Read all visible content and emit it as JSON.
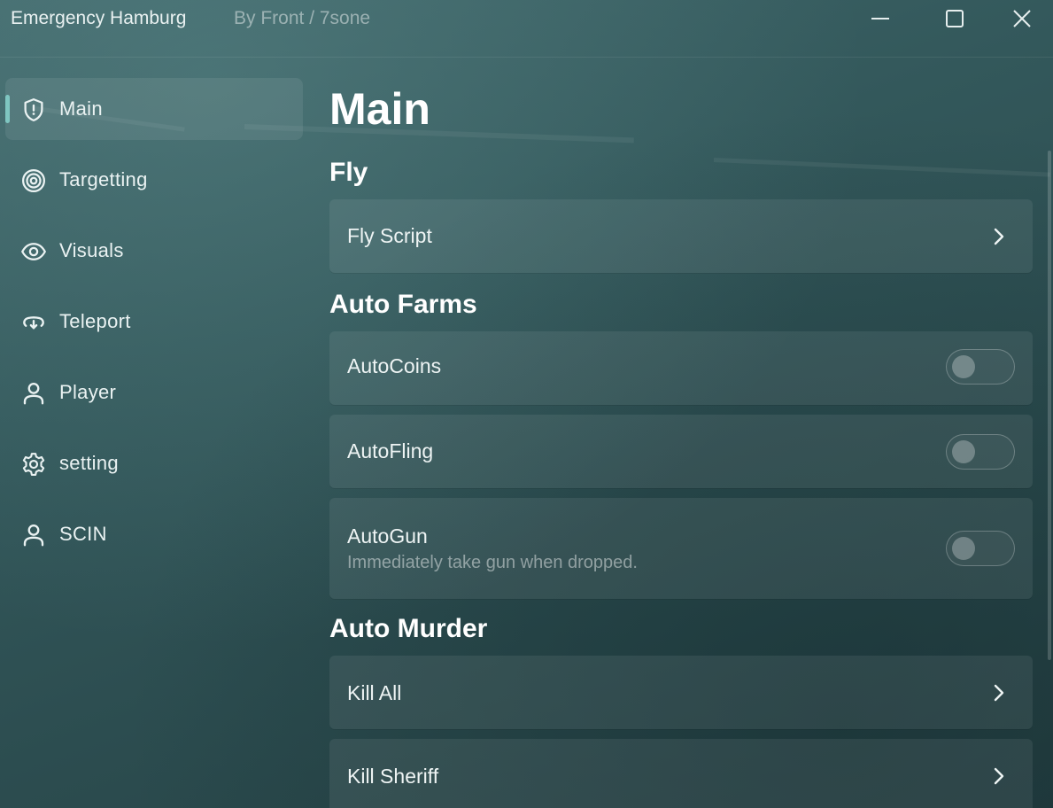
{
  "window": {
    "title": "Emergency Hamburg",
    "subtitle": "By Front / 7sone",
    "accent_color": "#7fc6c1"
  },
  "sidebar": {
    "items": [
      {
        "label": "Main",
        "icon": "shield-alert-icon",
        "active": true
      },
      {
        "label": "Targetting",
        "icon": "target-icon",
        "active": false
      },
      {
        "label": "Visuals",
        "icon": "eye-icon",
        "active": false
      },
      {
        "label": "Teleport",
        "icon": "teleport-icon",
        "active": false
      },
      {
        "label": "Player",
        "icon": "user-icon",
        "active": false
      },
      {
        "label": "setting",
        "icon": "gear-icon",
        "active": false
      },
      {
        "label": "SCIN",
        "icon": "user-icon",
        "active": false
      }
    ]
  },
  "main": {
    "title": "Main",
    "sections": [
      {
        "title": "Fly",
        "rows": [
          {
            "type": "button",
            "label": "Fly Script"
          }
        ]
      },
      {
        "title": "Auto Farms",
        "rows": [
          {
            "type": "toggle",
            "label": "AutoCoins",
            "on": false
          },
          {
            "type": "toggle",
            "label": "AutoFling",
            "on": false
          },
          {
            "type": "toggle",
            "label": "AutoGun",
            "description": "Immediately take gun when dropped.",
            "on": false
          }
        ]
      },
      {
        "title": "Auto Murder",
        "rows": [
          {
            "type": "button",
            "label": "Kill All"
          },
          {
            "type": "button",
            "label": "Kill Sheriff"
          }
        ]
      }
    ]
  }
}
